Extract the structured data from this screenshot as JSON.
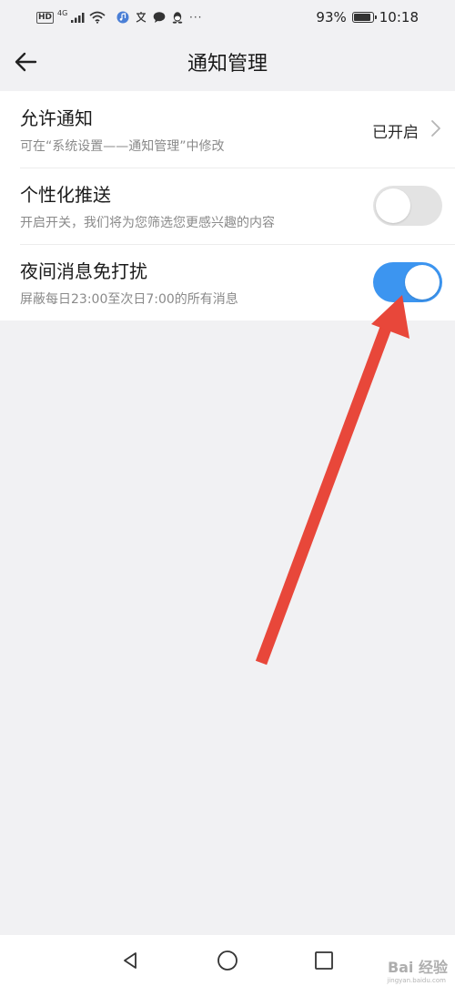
{
  "status_bar": {
    "hd_label": "HD",
    "network_type": "4G",
    "battery_text": "93%",
    "battery_level": 0.93,
    "time": "10:18",
    "more": "···",
    "app_icons": [
      "music-app-icon",
      "translate-app-icon",
      "message-app-icon",
      "qq-app-icon"
    ]
  },
  "header": {
    "title": "通知管理",
    "back_icon": "back-arrow-icon"
  },
  "settings": {
    "allow_notifications": {
      "title": "允许通知",
      "subtitle": "可在“系统设置——通知管理”中修改",
      "value": "已开启"
    },
    "personalized_push": {
      "title": "个性化推送",
      "subtitle": "开启开关，我们将为您筛选您更感兴趣的内容",
      "enabled": false
    },
    "night_dnd": {
      "title": "夜间消息免打扰",
      "subtitle": "屏蔽每日23:00至次日7:00的所有消息",
      "enabled": true
    }
  },
  "colors": {
    "toggle_on": "#3c95f0",
    "toggle_off": "#e3e3e3",
    "annotation_arrow": "#e8473a",
    "background": "#f1f1f3"
  },
  "nav": {
    "back": "nav-back-icon",
    "home": "nav-home-icon",
    "recents": "nav-recents-icon"
  },
  "watermark": {
    "text": "Bai 经验",
    "sub": "jingyan.baidu.com"
  }
}
